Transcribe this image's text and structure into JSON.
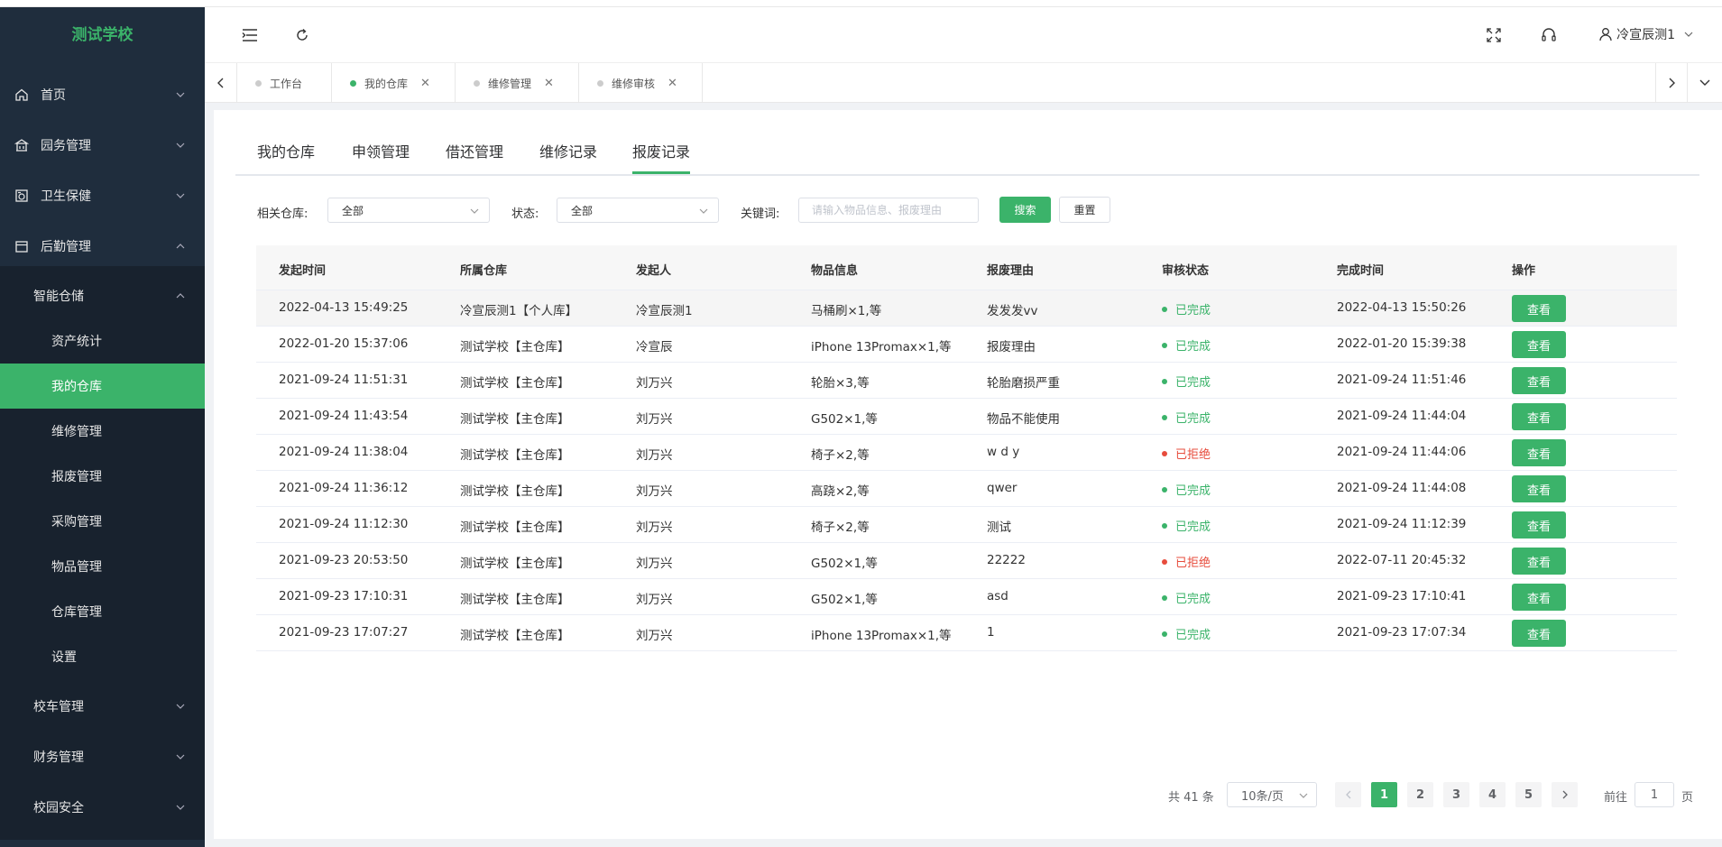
{
  "sidebar": {
    "logo": "测试学校",
    "menu": [
      {
        "label": "首页"
      },
      {
        "label": "园务管理"
      },
      {
        "label": "卫生保健"
      },
      {
        "label": "后勤管理"
      }
    ],
    "group": {
      "label": "智能仓储"
    },
    "subitems": [
      {
        "label": "资产统计"
      },
      {
        "label": "我的仓库"
      },
      {
        "label": "维修管理"
      },
      {
        "label": "报废管理"
      },
      {
        "label": "采购管理"
      },
      {
        "label": "物品管理"
      },
      {
        "label": "仓库管理"
      },
      {
        "label": "设置"
      }
    ],
    "more": [
      {
        "label": "校车管理"
      },
      {
        "label": "财务管理"
      },
      {
        "label": "校园安全"
      }
    ]
  },
  "header": {
    "user": "冷宣辰测1"
  },
  "tags": [
    {
      "label": "工作台"
    },
    {
      "label": "我的仓库"
    },
    {
      "label": "维修管理"
    },
    {
      "label": "维修审核"
    }
  ],
  "subtabs": [
    "我的仓库",
    "申领管理",
    "借还管理",
    "维修记录",
    "报废记录"
  ],
  "filters": {
    "warehouse_label": "相关仓库:",
    "warehouse_value": "全部",
    "status_label": "状态:",
    "status_value": "全部",
    "keyword_label": "关键词:",
    "keyword_placeholder": "请输入物品信息、报废理由",
    "search": "搜索",
    "reset": "重置"
  },
  "table": {
    "columns": [
      "发起时间",
      "所属仓库",
      "发起人",
      "物品信息",
      "报废理由",
      "审核状态",
      "完成时间",
      "操作"
    ],
    "action": "查看",
    "rows": [
      [
        "2022-04-13 15:49:25",
        "冷宣辰测1【个人库】",
        "冷宣辰测1",
        "马桶刷×1,等",
        "发发发vv",
        "已完成",
        "2022-04-13 15:50:26"
      ],
      [
        "2022-01-20 15:37:06",
        "测试学校【主仓库】",
        "冷宣辰",
        "iPhone 13Promax×1,等",
        "报废理由",
        "已完成",
        "2022-01-20 15:39:38"
      ],
      [
        "2021-09-24 11:51:31",
        "测试学校【主仓库】",
        "刘万兴",
        "轮胎×3,等",
        "轮胎磨损严重",
        "已完成",
        "2021-09-24 11:51:46"
      ],
      [
        "2021-09-24 11:43:54",
        "测试学校【主仓库】",
        "刘万兴",
        "G502×1,等",
        "物品不能使用",
        "已完成",
        "2021-09-24 11:44:04"
      ],
      [
        "2021-09-24 11:38:04",
        "测试学校【主仓库】",
        "刘万兴",
        "椅子×2,等",
        "w d y",
        "已拒绝",
        "2021-09-24 11:44:06"
      ],
      [
        "2021-09-24 11:36:12",
        "测试学校【主仓库】",
        "刘万兴",
        "高跷×2,等",
        "qwer",
        "已完成",
        "2021-09-24 11:44:08"
      ],
      [
        "2021-09-24 11:12:30",
        "测试学校【主仓库】",
        "刘万兴",
        "椅子×2,等",
        "测试",
        "已完成",
        "2021-09-24 11:12:39"
      ],
      [
        "2021-09-23 20:53:50",
        "测试学校【主仓库】",
        "刘万兴",
        "G502×1,等",
        "22222",
        "已拒绝",
        "2022-07-11 20:45:32"
      ],
      [
        "2021-09-23 17:10:31",
        "测试学校【主仓库】",
        "刘万兴",
        "G502×1,等",
        "asd",
        "已完成",
        "2021-09-23 17:10:41"
      ],
      [
        "2021-09-23 17:07:27",
        "测试学校【主仓库】",
        "刘万兴",
        "iPhone 13Promax×1,等",
        "1",
        "已完成",
        "2021-09-23 17:07:34"
      ]
    ]
  },
  "pagination": {
    "total": "共 41 条",
    "page_size": "10条/页",
    "pages": [
      "1",
      "2",
      "3",
      "4",
      "5"
    ],
    "goto_label": "前往",
    "goto_value": "1",
    "page_suffix": "页"
  },
  "colors": {
    "accent": "#3bb36a",
    "sidebar_bg": "#1f2d3d",
    "reject": "#e74c3c"
  },
  "icons": {
    "menu": [
      "home-icon",
      "building-icon",
      "health-icon",
      "logistics-icon"
    ]
  }
}
